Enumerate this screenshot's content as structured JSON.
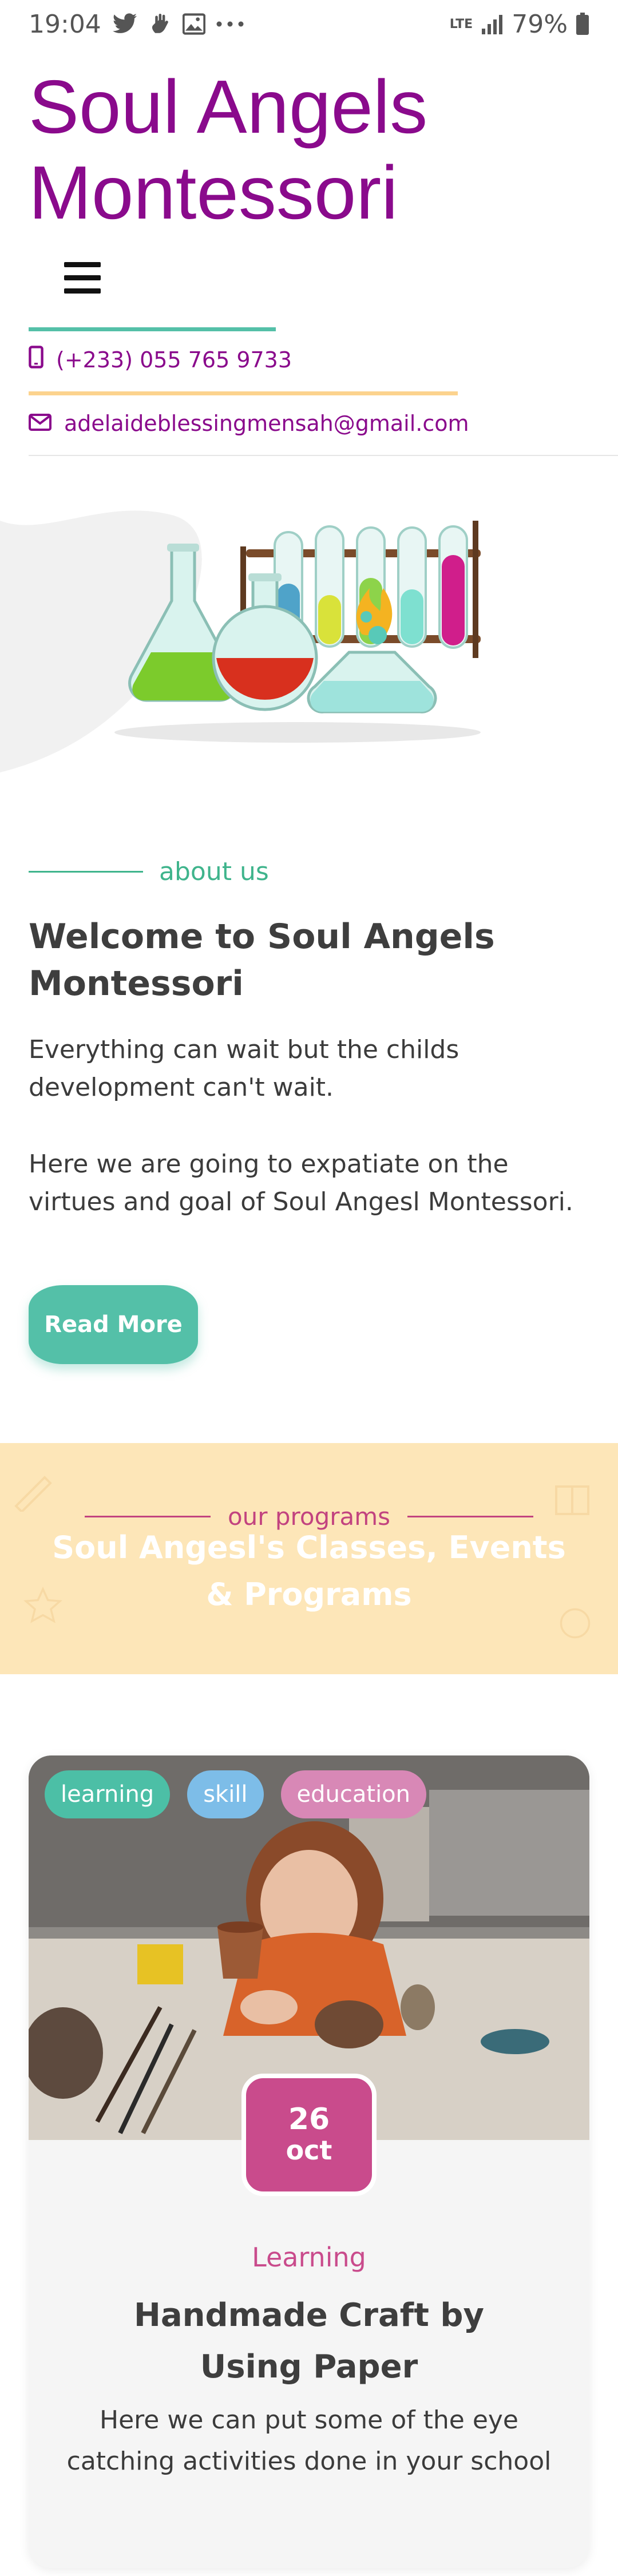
{
  "status_bar": {
    "time": "19:04",
    "battery": "79%",
    "network": "LTE"
  },
  "site": {
    "title": "Soul Angels Montessori"
  },
  "contact": {
    "phone": "(+233) 055 765 9733",
    "email": "adelaideblessingmensah@gmail.com"
  },
  "about": {
    "eyebrow": "about us",
    "heading": "Welcome to Soul Angels Montessori",
    "paragraph1": "Everything can wait but the childs development can't wait.",
    "paragraph2": "Here we are going to expatiate on the virtues and goal of Soul Angesl Montessori.",
    "read_more": "Read More"
  },
  "programs": {
    "eyebrow": "our programs",
    "title": "Soul Angesl's Classes, Events & Programs"
  },
  "card": {
    "tags": [
      {
        "label": "learning",
        "color": "#4cbfa6"
      },
      {
        "label": "skill",
        "color": "#7dbde8"
      },
      {
        "label": "education",
        "color": "#d888b6"
      }
    ],
    "date_day": "26",
    "date_month": "oct",
    "category": "Learning",
    "title": "Handmade Craft by Using Paper",
    "text": "Here we can put some of the eye catching activities done in your school"
  },
  "colors": {
    "brand": "#8a0a8c",
    "teal": "#54c0a8",
    "pink": "#c94b8c",
    "cream": "#fde6b8"
  }
}
